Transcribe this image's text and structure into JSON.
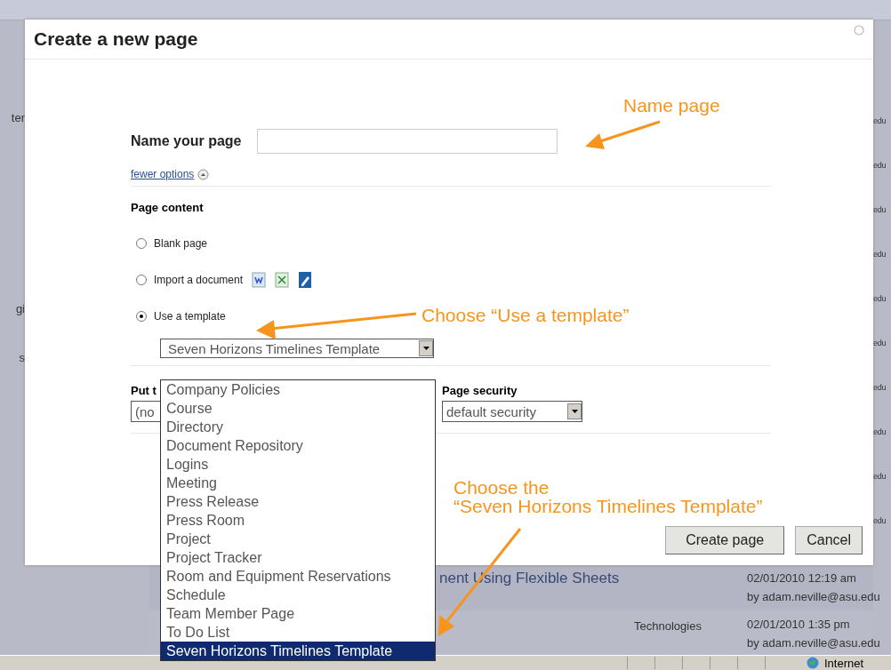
{
  "background": {
    "left_fragments": [
      "ter",
      "gi",
      "s"
    ],
    "right_fragments": [
      "edu",
      "edu",
      "edu",
      "edu",
      "edu",
      "edu",
      "edu",
      "edu",
      "edu",
      "edu"
    ],
    "rows": [
      {
        "title": "nent Using Flexible Sheets",
        "category": "",
        "date": "02/01/2010 12:19 am",
        "author": "by adam.neville@asu.edu"
      },
      {
        "title": "",
        "category": "Technologies",
        "date": "02/01/2010 1:35 pm",
        "author": "by adam.neville@asu.edu"
      }
    ],
    "status_bar": {
      "zone": "Internet"
    }
  },
  "dialog": {
    "title": "Create a new page",
    "name_label": "Name your page",
    "options_link": "fewer options",
    "page_content_label": "Page content",
    "content_options": [
      {
        "kind": "blank",
        "label": "Blank page",
        "selected": false
      },
      {
        "kind": "import",
        "label": "Import a document",
        "selected": false
      },
      {
        "kind": "template",
        "label": "Use a template",
        "selected": true
      }
    ],
    "template_select": {
      "value": "Seven Horizons Timelines Template",
      "expanded": true,
      "options": [
        {
          "label": "Company Policies",
          "selected": false
        },
        {
          "label": "Course",
          "selected": false
        },
        {
          "label": "Directory",
          "selected": false
        },
        {
          "label": "Document Repository",
          "selected": false
        },
        {
          "label": "Logins",
          "selected": false
        },
        {
          "label": "Meeting",
          "selected": false
        },
        {
          "label": "Press Release",
          "selected": false
        },
        {
          "label": "Press Room",
          "selected": false
        },
        {
          "label": "Project",
          "selected": false
        },
        {
          "label": "Project Tracker",
          "selected": false
        },
        {
          "label": "Room and Equipment Reservations",
          "selected": false
        },
        {
          "label": "Schedule",
          "selected": false
        },
        {
          "label": "Team Member Page",
          "selected": false
        },
        {
          "label": "To Do List",
          "selected": false
        },
        {
          "label": "Seven Horizons Timelines Template",
          "selected": true
        }
      ]
    },
    "put_label": "Put t",
    "put_value": "(no",
    "security_label": "Page security",
    "security_value": "default security",
    "buttons": [
      "Create page",
      "Cancel"
    ]
  },
  "annotations": [
    {
      "text": "Name page"
    },
    {
      "text": "Choose “Use a template”"
    },
    {
      "text": "Choose the\n“Seven Horizons Timelines Template”"
    }
  ]
}
